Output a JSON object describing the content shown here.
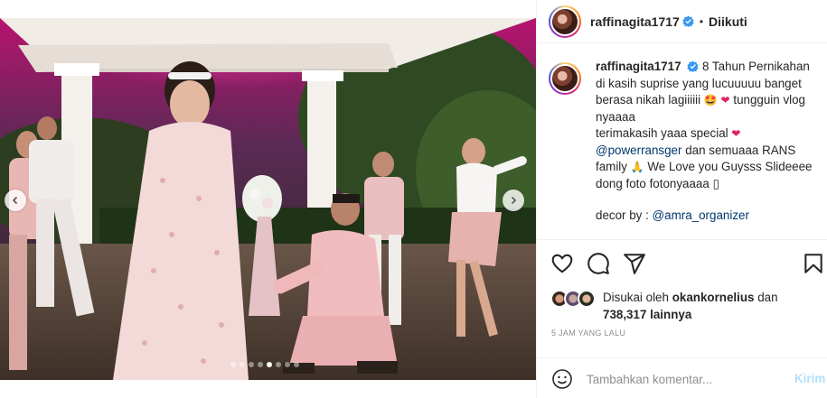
{
  "post": {
    "author": "raffinagita1717",
    "follow_status": "Diikuti",
    "separator": "•",
    "image": {
      "slide_count": 8,
      "active_slide": 5,
      "description_icon": "photo-slideshow"
    }
  },
  "caption": {
    "username": "raffinagita1717",
    "line1": "8 Tahun Pernikahan di kasih suprise yang lucuuuuu banget berasa nikah lagiiiiii",
    "emoji_star_eyes": "🤩",
    "emoji_heart": "❤",
    "line1_end": "tungguin vlog nyaaaa",
    "line2": "terimakasih yaaa special",
    "mention1": "@powerransger",
    "line3": "dan semuaaa RANS family",
    "emoji_pray": "🙏",
    "line3_end": "We Love you Guysss Slideeee dong foto fotonyaaaa",
    "trailing_glyph": "▯",
    "decor_label": "decor by :",
    "mention2": "@amra_organizer"
  },
  "actions": {
    "like_icon": "heart-icon",
    "comment_icon": "comment-icon",
    "share_icon": "share-icon",
    "save_icon": "bookmark-icon"
  },
  "likes": {
    "prefix": "Disukai oleh",
    "user": "okankornelius",
    "and": "dan",
    "count": "738,317",
    "suffix": "lainnya"
  },
  "timestamp": "5 JAM YANG LALU",
  "comment": {
    "placeholder": "Tambahkan komentar...",
    "send_label": "Kirim"
  },
  "colors": {
    "verified": "#3897f0",
    "mention": "#00376b",
    "send_disabled": "#b2dffc",
    "muted": "#8e8e8e"
  }
}
